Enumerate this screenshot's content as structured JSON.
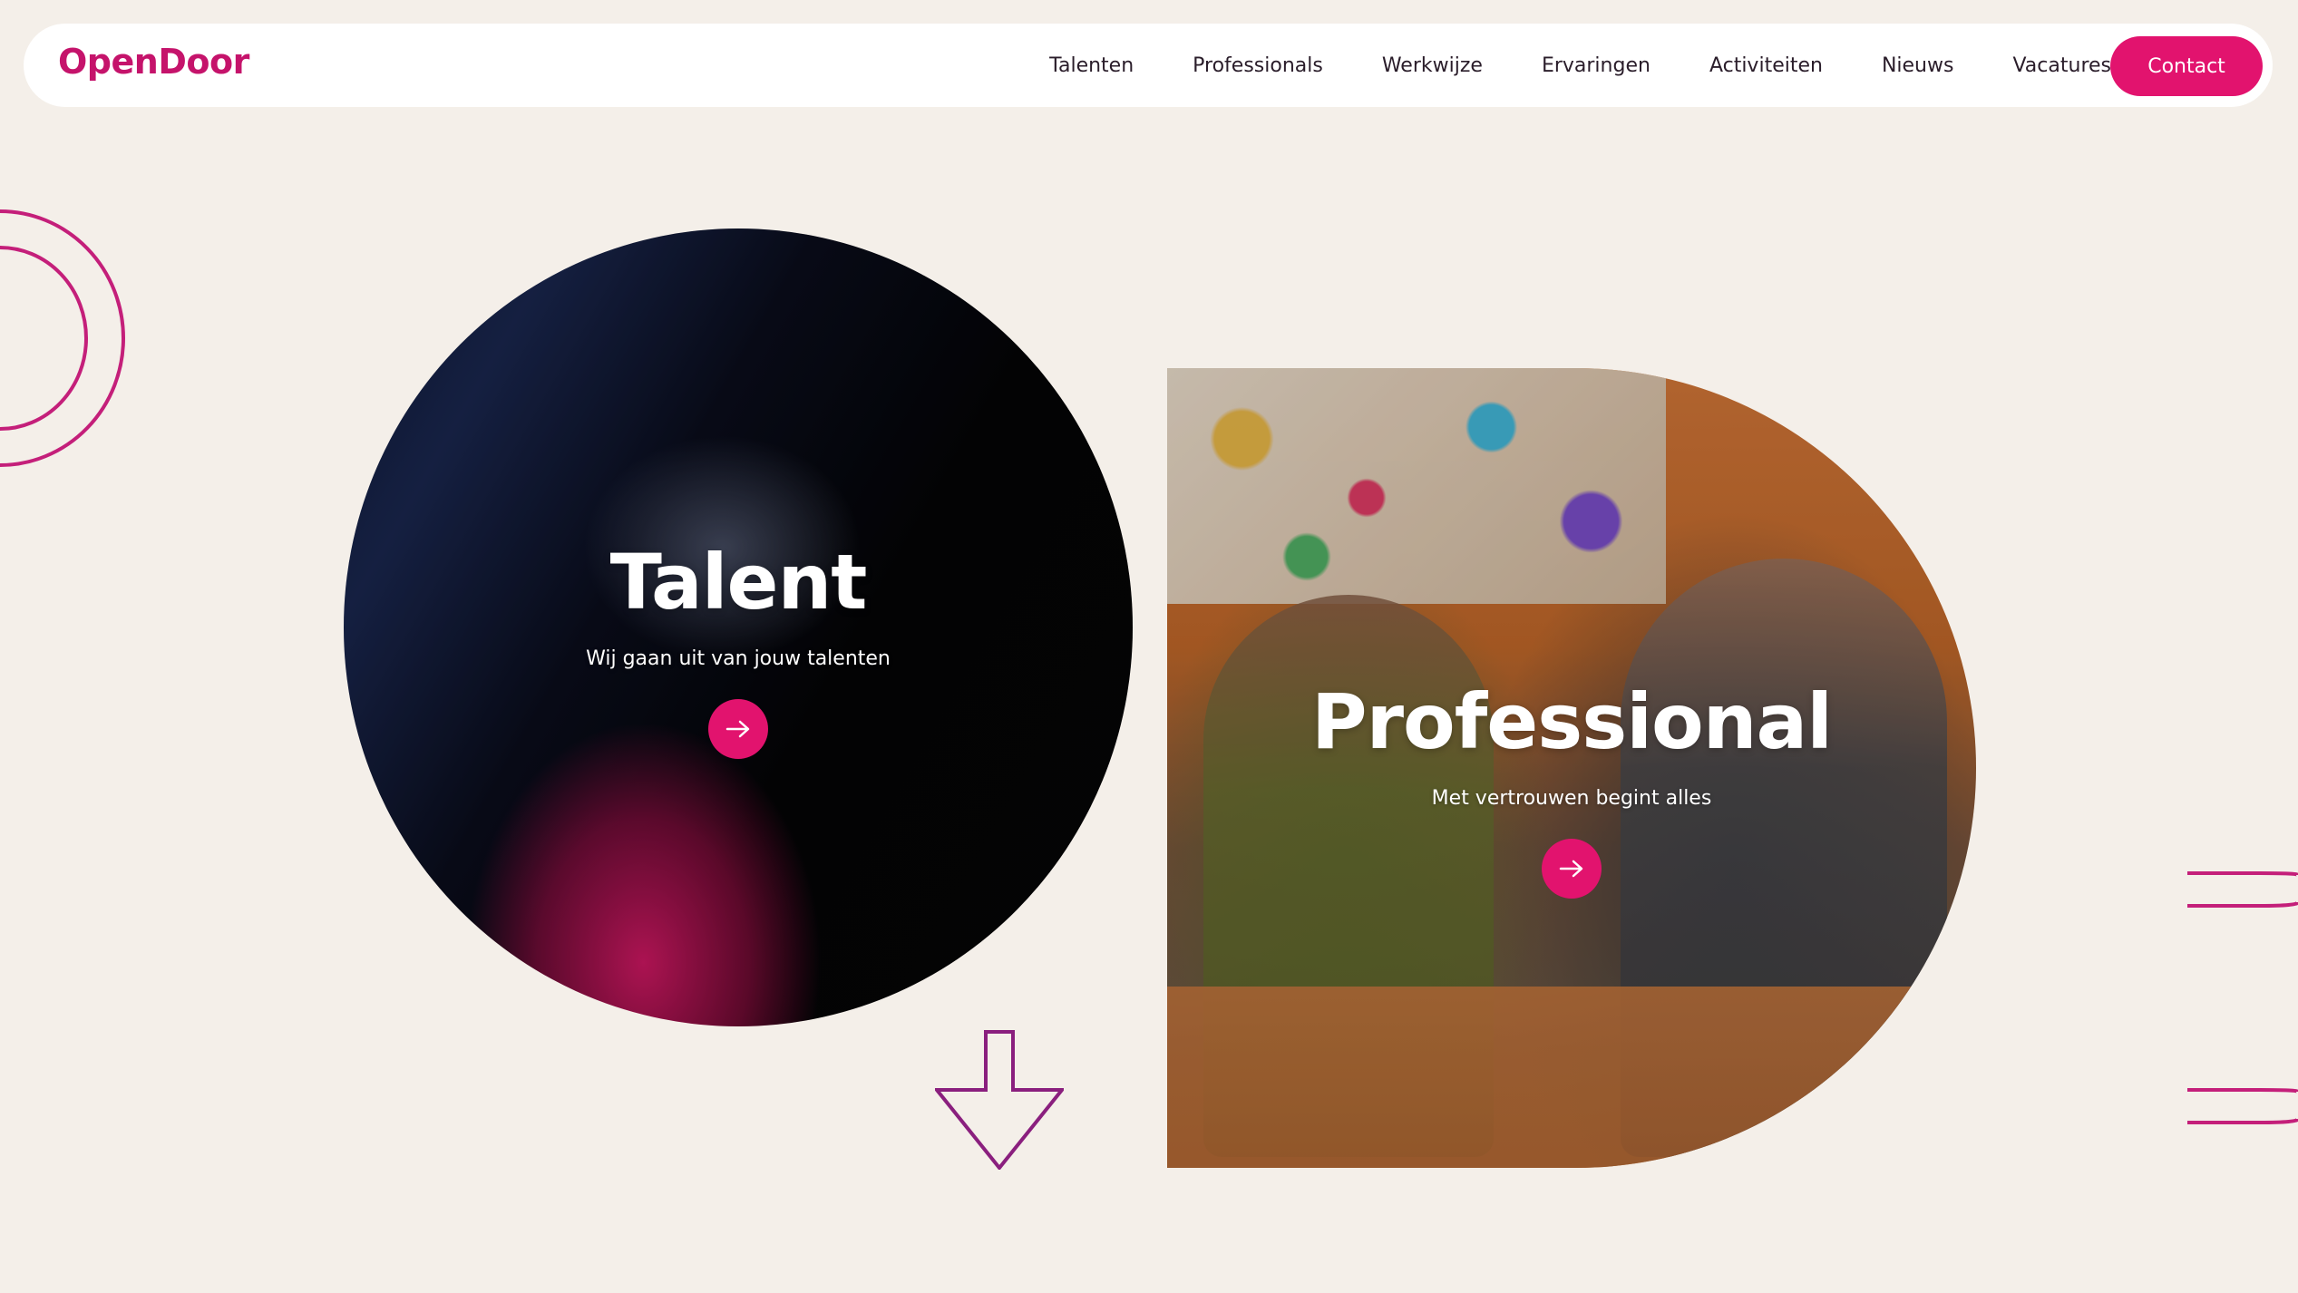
{
  "brand": {
    "logo_text": "OpenDoor",
    "color": "#c5136b"
  },
  "nav": {
    "items": [
      {
        "label": "Talenten"
      },
      {
        "label": "Professionals"
      },
      {
        "label": "Werkwijze"
      },
      {
        "label": "Ervaringen"
      },
      {
        "label": "Activiteiten"
      },
      {
        "label": "Nieuws"
      },
      {
        "label": "Vacatures"
      }
    ],
    "contact_label": "Contact"
  },
  "hero": {
    "talent": {
      "title": "Talent",
      "subtitle": "Wij gaan uit van jouw talenten",
      "button_icon": "arrow-right-icon"
    },
    "professional": {
      "title": "Professional",
      "subtitle": "Met vertrouwen begint alles",
      "button_icon": "arrow-right-icon"
    },
    "scroll_icon": "arrow-down-icon"
  },
  "colors": {
    "accent": "#e2136e",
    "decoration": "#c41f7a",
    "arrow_outline": "#8a1f7e",
    "background": "#f4efe9",
    "nav_text": "#2a1d2a"
  }
}
